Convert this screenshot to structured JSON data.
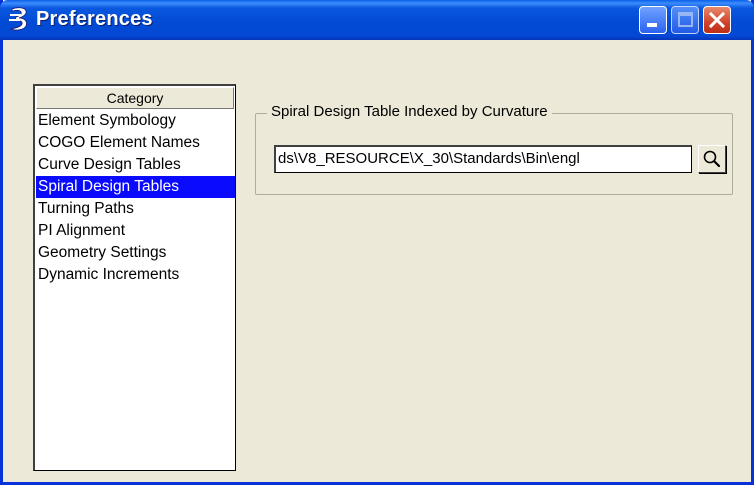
{
  "window": {
    "title": "Preferences",
    "app_icon": "bentley-b-icon",
    "controls": [
      "minimize-icon",
      "maximize-icon",
      "close-icon"
    ]
  },
  "category_list": {
    "header": "Category",
    "items": [
      {
        "label": "Element Symbology",
        "selected": false
      },
      {
        "label": "COGO Element Names",
        "selected": false
      },
      {
        "label": "Curve Design Tables",
        "selected": false
      },
      {
        "label": "Spiral Design Tables",
        "selected": true
      },
      {
        "label": "Turning Paths",
        "selected": false
      },
      {
        "label": "PI Alignment",
        "selected": false
      },
      {
        "label": "Geometry Settings",
        "selected": false
      },
      {
        "label": "Dynamic Increments",
        "selected": false
      }
    ]
  },
  "spiral_panel": {
    "group_label": "Spiral Design Table Indexed by Curvature",
    "path_value": "ds\\V8_RESOURCE\\X_30\\Standards\\Bin\\engl",
    "browse_icon": "magnifier-icon"
  },
  "colors": {
    "title_bar": "#0249d3",
    "selection": "#0a0aff",
    "dialog_bg": "#ece9d8",
    "close_button": "#d0432a"
  }
}
